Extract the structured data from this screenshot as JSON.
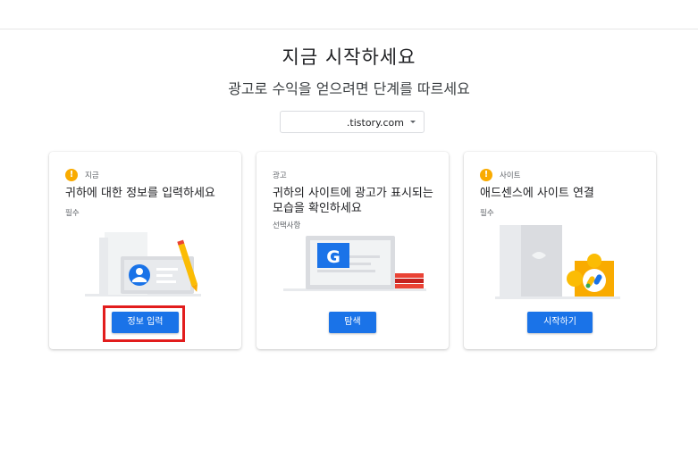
{
  "heading": {
    "title": "지금 시작하세요",
    "subtitle": "광고로 수익을 얻으려면 단계를 따르세요"
  },
  "site_select": {
    "value": ".tistory.com"
  },
  "cards": [
    {
      "tag": "지금",
      "title": "귀하에 대한 정보를 입력하세요",
      "sub": "필수",
      "button": "정보 입력",
      "icon": "warning-icon"
    },
    {
      "tag": "광고",
      "title": "귀하의 사이트에 광고가 표시되는 모습을 확인하세요",
      "sub": "선택사항",
      "button": "탐색"
    },
    {
      "tag": "사이트",
      "title": "애드센스에 사이트 연결",
      "sub": "필수",
      "button": "시작하기",
      "icon": "warning-icon"
    }
  ],
  "colors": {
    "primary": "#1a73e8",
    "warning": "#f9ab00",
    "highlight": "#e21d1d"
  }
}
